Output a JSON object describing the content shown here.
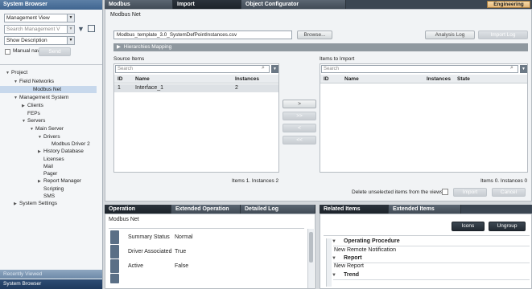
{
  "system_browser": {
    "title": "System Browser",
    "view_select": "Management View",
    "search_placeholder": "Search Management V",
    "description_select": "Show Description",
    "manual_label": "Manual nav",
    "send_label": "Send"
  },
  "tree": [
    {
      "label": "Project",
      "level": 0,
      "toggle": "▼",
      "selected": false
    },
    {
      "label": "Field Networks",
      "level": 1,
      "toggle": "▼",
      "selected": false
    },
    {
      "label": "Modbus Net",
      "level": 2,
      "toggle": "",
      "selected": true
    },
    {
      "label": "Management System",
      "level": 1,
      "toggle": "▼",
      "selected": false
    },
    {
      "label": "Clients",
      "level": 2,
      "toggle": "▶",
      "selected": false
    },
    {
      "label": "FEPs",
      "level": 2,
      "toggle": "",
      "selected": false
    },
    {
      "label": "Servers",
      "level": 2,
      "toggle": "▼",
      "selected": false
    },
    {
      "label": "Main Server",
      "level": 3,
      "toggle": "▼",
      "selected": false
    },
    {
      "label": "Drivers",
      "level": 4,
      "toggle": "▼",
      "selected": false
    },
    {
      "label": "Modbus Driver 2",
      "level": 5,
      "toggle": "",
      "selected": false
    },
    {
      "label": "History Database",
      "level": 4,
      "toggle": "▶",
      "selected": false
    },
    {
      "label": "Licenses",
      "level": 4,
      "toggle": "",
      "selected": false
    },
    {
      "label": "Mail",
      "level": 4,
      "toggle": "",
      "selected": false
    },
    {
      "label": "Pager",
      "level": 4,
      "toggle": "",
      "selected": false
    },
    {
      "label": "Report Manager",
      "level": 4,
      "toggle": "▶",
      "selected": false
    },
    {
      "label": "Scripting",
      "level": 4,
      "toggle": "",
      "selected": false
    },
    {
      "label": "SMS",
      "level": 4,
      "toggle": "",
      "selected": false
    },
    {
      "label": "System Settings",
      "level": 1,
      "toggle": "▶",
      "selected": false
    }
  ],
  "recently_viewed": "Recently Viewed",
  "system_browser_footer": "System Browser",
  "top_tabs": [
    "Modbus",
    "Import",
    "Object Configurator"
  ],
  "engineering_label": "Engineering",
  "import": {
    "net_title": "Modbus Net",
    "file_path": "Modbus_template_3.0_SystemDefPointInstances.csv",
    "browse_label": "Browse...",
    "analysis_log_label": "Analysis Log",
    "import_log_label": "Import Log",
    "hierarchies_label": "Hierarchies Mapping",
    "source_title": "Source Items",
    "target_title": "Items to Import",
    "search_placeholder": "Search",
    "source_columns": [
      "ID",
      "Name",
      "Instances"
    ],
    "source_rows": [
      {
        "id": "1",
        "name": "Interface_1",
        "instances": "2"
      }
    ],
    "target_columns": [
      "ID",
      "Name",
      "Instances",
      "State"
    ],
    "move_buttons": [
      ">",
      ">>",
      "<",
      "<<"
    ],
    "source_status": "Items 1. Instances 2",
    "target_status": "Items 0. Instances 0",
    "delete_label": "Delete unselected items from the views:",
    "import_label": "Import",
    "cancel_label": "Cancel"
  },
  "bottom_left_tabs": [
    "Operation",
    "Extended Operation",
    "Detailed Log"
  ],
  "operation": {
    "title": "Modbus Net",
    "rows": [
      {
        "label": "Summary Status",
        "value": "Normal"
      },
      {
        "label": "Driver Associated",
        "value": "True"
      },
      {
        "label": "Active",
        "value": "False"
      }
    ]
  },
  "bottom_right_tabs": [
    "Related Items",
    "Extended Items"
  ],
  "related": {
    "icons_label": "Icons",
    "ungroup_label": "Ungroup",
    "groups": [
      {
        "title": "Operating Procedure",
        "item": "New Remote Notification"
      },
      {
        "title": "Report",
        "item": "New Report"
      },
      {
        "title": "Trend",
        "item": ""
      }
    ]
  }
}
